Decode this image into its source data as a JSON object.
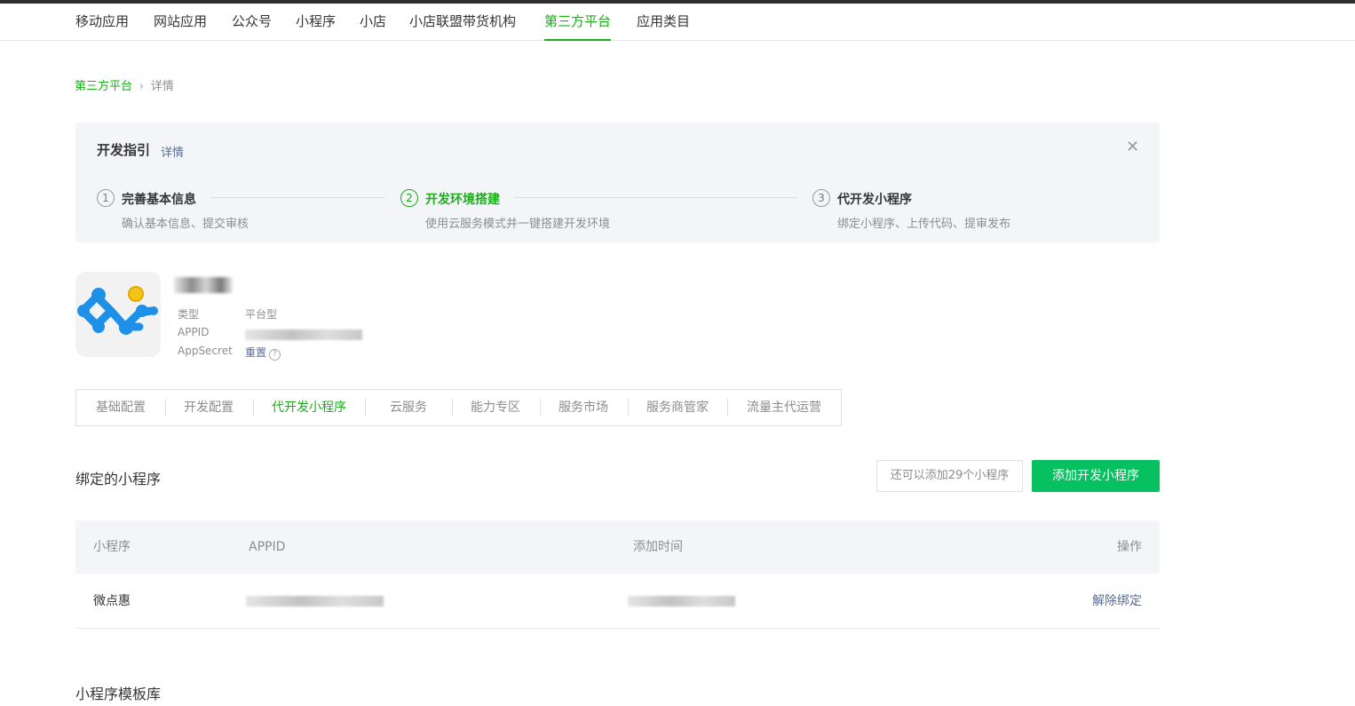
{
  "nav": {
    "items": [
      {
        "label": "移动应用"
      },
      {
        "label": "网站应用"
      },
      {
        "label": "公众号"
      },
      {
        "label": "小程序"
      },
      {
        "label": "小店"
      },
      {
        "label": "小店联盟带货机构"
      },
      {
        "label": "第三方平台",
        "active": true
      },
      {
        "label": "应用类目"
      }
    ]
  },
  "breadcrumb": {
    "parent": "第三方平台",
    "separator": "›",
    "current": "详情"
  },
  "guide": {
    "title": "开发指引",
    "detail_link": "详情",
    "close_glyph": "✕",
    "steps": [
      {
        "num": "1",
        "title": "完善基本信息",
        "desc": "确认基本信息、提交审核",
        "active": false
      },
      {
        "num": "2",
        "title": "开发环境搭建",
        "desc": "使用云服务模式并一键搭建开发环境",
        "active": true
      },
      {
        "num": "3",
        "title": "代开发小程序",
        "desc": "绑定小程序、上传代码、提审发布",
        "active": false
      }
    ]
  },
  "app": {
    "type_label": "类型",
    "type_value": "平台型",
    "appid_label": "APPID",
    "secret_label": "AppSecret",
    "secret_reset": "重置",
    "help_glyph": "?"
  },
  "tabs": [
    {
      "label": "基础配置"
    },
    {
      "label": "开发配置"
    },
    {
      "label": "代开发小程序",
      "active": true
    },
    {
      "label": "云服务"
    },
    {
      "label": "能力专区"
    },
    {
      "label": "服务市场"
    },
    {
      "label": "服务商管家"
    },
    {
      "label": "流量主代运营"
    }
  ],
  "bound": {
    "title": "绑定的小程序",
    "quota_text": "还可以添加29个小程序",
    "add_button": "添加开发小程序",
    "columns": [
      "小程序",
      "APPID",
      "添加时间",
      "操作"
    ],
    "rows": [
      {
        "name": "微点惠",
        "action": "解除绑定"
      }
    ]
  },
  "template_lib": {
    "title": "小程序模板库"
  },
  "colors": {
    "accent": "#1aad19",
    "button": "#07c160",
    "link": "#576b95"
  }
}
